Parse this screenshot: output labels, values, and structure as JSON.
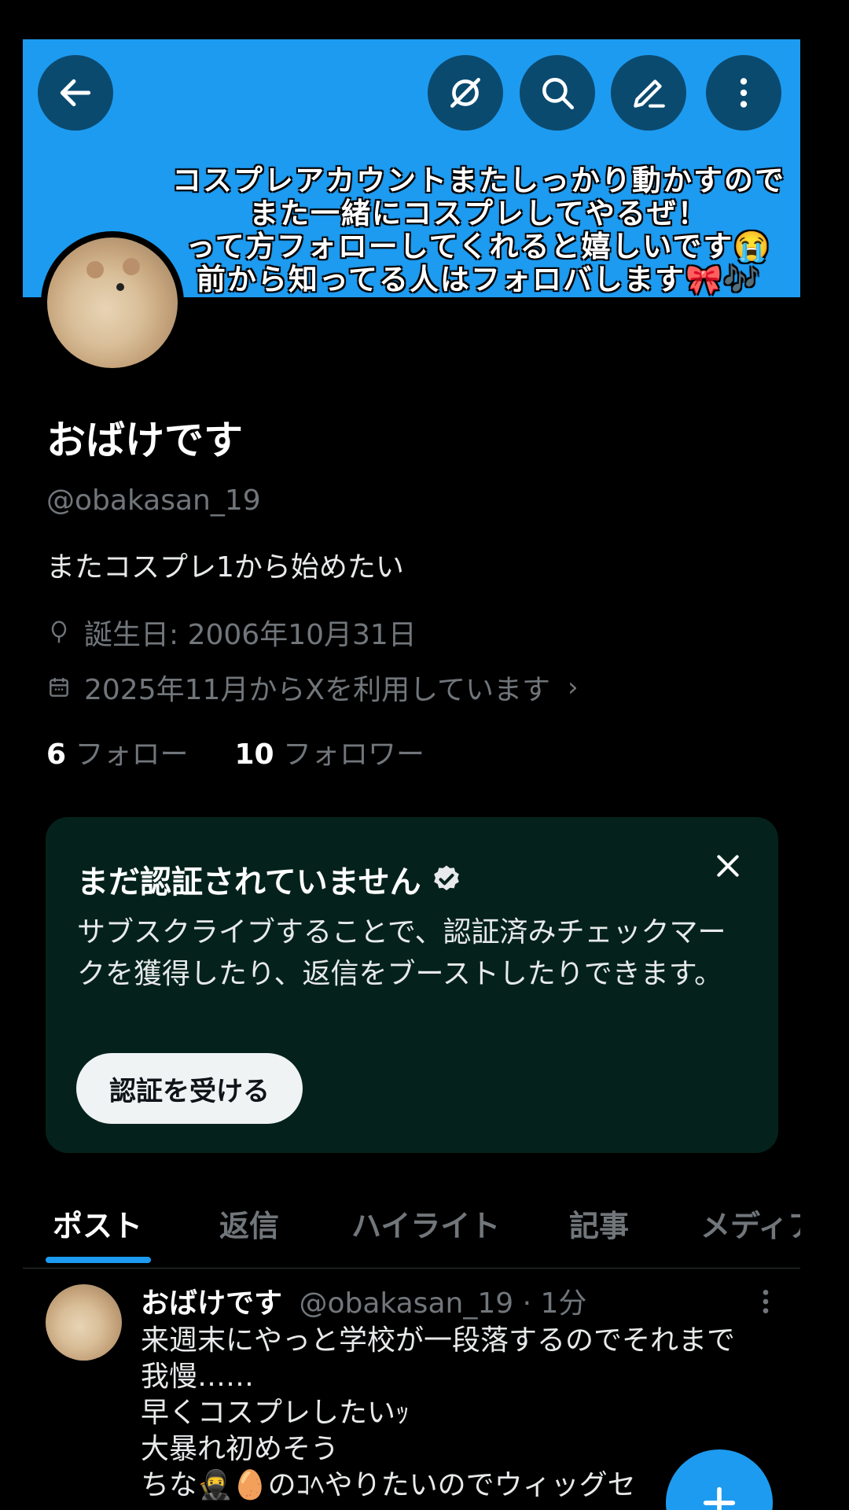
{
  "banner": {
    "overlay_lines": [
      "コスプレアカウントまたしっかり動かすので",
      "また一緒にコスプレしてやるぜ！",
      "って方フォローしてくれると嬉しいです😭",
      "前から知ってる人はフォロバします🎀🎶"
    ],
    "icons": [
      "back-arrow-icon",
      "grok-icon",
      "search-icon",
      "edit-icon",
      "more-vertical-icon"
    ]
  },
  "profile": {
    "display_name": "おばけです",
    "handle": "@obakasan_19",
    "bio": "またコスプレ1から始めたい",
    "birthday": "誕生日: 2006年10月31日",
    "joined": "2025年11月からXを利用しています",
    "following_count": "6",
    "following_label": "フォロー",
    "followers_count": "10",
    "followers_label": "フォロワー"
  },
  "verify_card": {
    "title": "まだ認証されていません",
    "body": "サブスクライブすることで、認証済みチェックマークを獲得したり、返信をブーストしたりできます。",
    "button_label": "認証を受ける"
  },
  "tabs": [
    {
      "label": "ポスト",
      "active": true
    },
    {
      "label": "返信",
      "active": false
    },
    {
      "label": "ハイライト",
      "active": false
    },
    {
      "label": "記事",
      "active": false
    },
    {
      "label": "メディア",
      "active": false
    }
  ],
  "post": {
    "author": "おばけです",
    "meta": "@obakasan_19 · 1分",
    "lines": [
      "来週末にやっと学校が一段落するのでそれまで",
      "我慢……",
      "早くコスプレしたいｯ",
      "大暴れ初めそう",
      "ちな🥷🥚のｺﾍやりたいのでウィッグセ"
    ]
  },
  "colors": {
    "accent": "#1d9bf0",
    "banner_button": "#0b4a6f",
    "verify_card_bg": "#04221b",
    "muted_text": "#71767b"
  }
}
